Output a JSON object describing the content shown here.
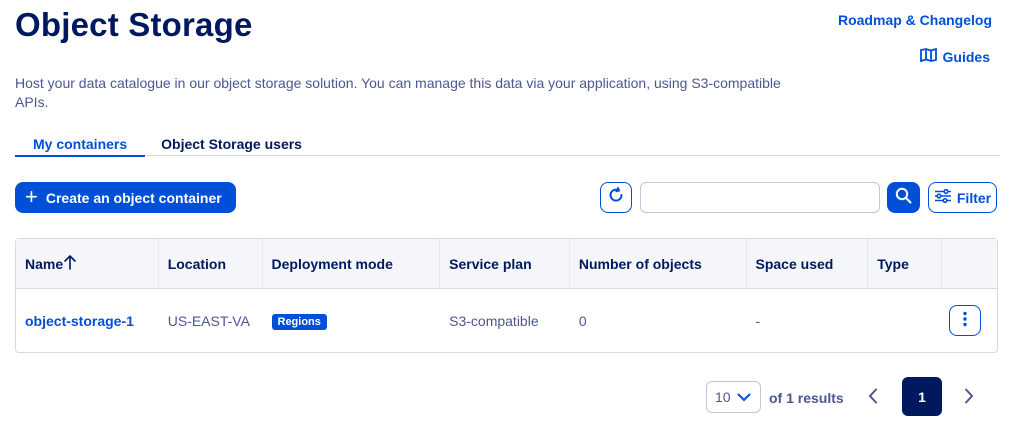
{
  "header": {
    "title": "Object Storage",
    "roadmap_link": "Roadmap & Changelog",
    "guides_link": "Guides",
    "description": "Host your data catalogue in our object storage solution. You can manage this data via your application, using S3-compatible APIs."
  },
  "tabs": [
    {
      "label": "My containers",
      "active": true
    },
    {
      "label": "Object Storage users",
      "active": false
    }
  ],
  "toolbar": {
    "create_label": "Create an object container",
    "search_value": "",
    "filter_label": "Filter"
  },
  "table": {
    "columns": [
      "Name",
      "Location",
      "Deployment mode",
      "Service plan",
      "Number of objects",
      "Space used",
      "Type",
      ""
    ],
    "sort_column": "Name",
    "sort_direction": "ascending",
    "rows": [
      {
        "name": "object-storage-1",
        "location": "US-EAST-VA",
        "deployment_mode": "Regions",
        "service_plan": "S3-compatible",
        "number_of_objects": "0",
        "space_used": "-",
        "type": ""
      }
    ]
  },
  "pagination": {
    "page_size": "10",
    "results_text": "of 1 results",
    "current_page": "1"
  },
  "colors": {
    "primary": "#0050d7",
    "heading": "#00185e",
    "text": "#4d5693"
  }
}
